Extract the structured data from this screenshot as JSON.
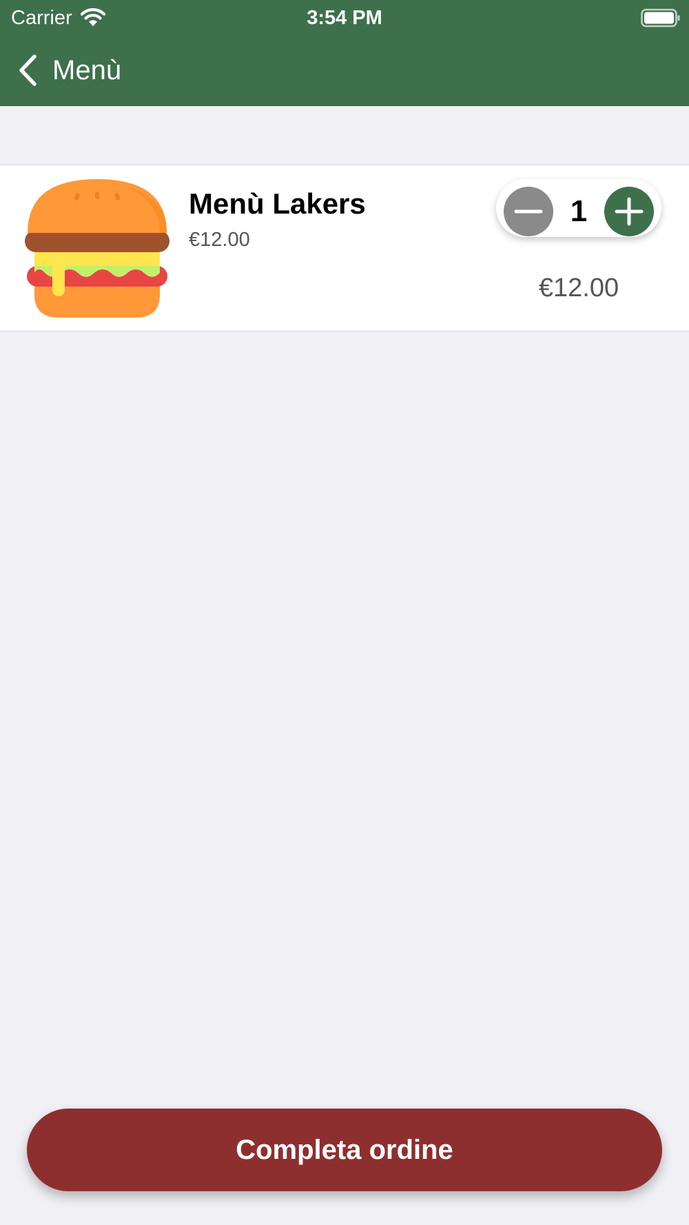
{
  "status_bar": {
    "carrier": "Carrier",
    "time": "3:54 PM",
    "wifi_icon": "wifi-icon",
    "battery_icon": "battery-icon"
  },
  "nav": {
    "back_icon": "chevron-left-icon",
    "back_label": "Menù"
  },
  "cart": {
    "items": [
      {
        "icon": "burger-icon",
        "name": "Menù Lakers",
        "unit_price": "€12.00",
        "quantity": "1",
        "total": "€12.00"
      }
    ]
  },
  "footer": {
    "complete_label": "Completa ordine"
  },
  "colors": {
    "header_green": "#3e704b",
    "background": "#f0f0f5",
    "plus_button": "#3e704b",
    "minus_button": "#8a8a8a",
    "complete_button": "#8e2f2f"
  }
}
